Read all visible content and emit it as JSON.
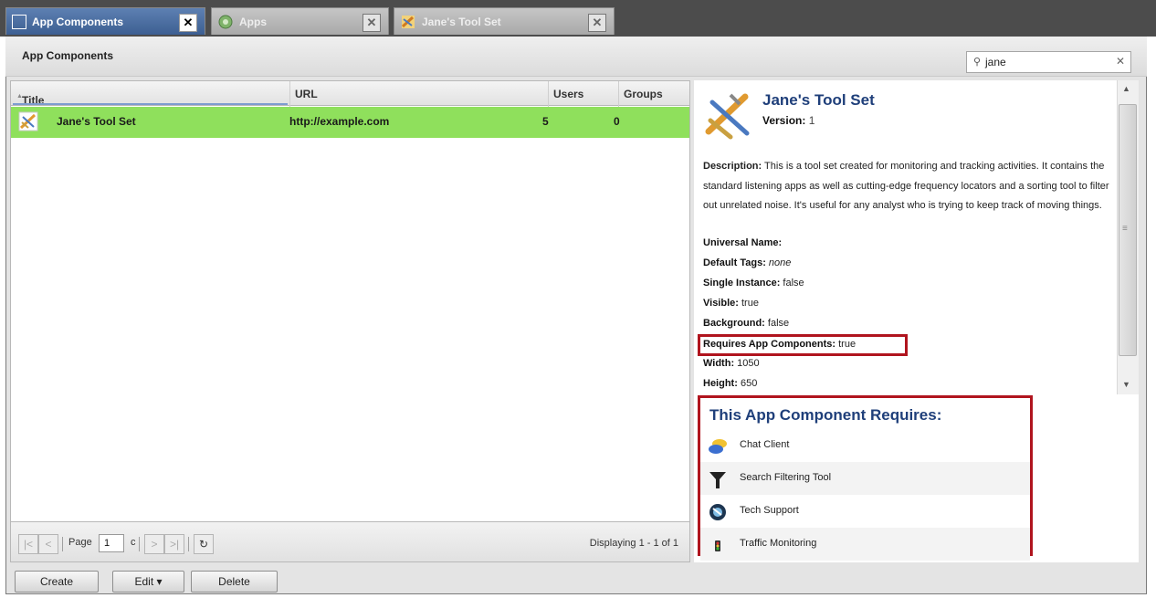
{
  "tabs": [
    {
      "label": "App Components",
      "close": "✕",
      "active": true
    },
    {
      "label": "Apps",
      "close": "✕",
      "active": false
    },
    {
      "label": "Jane's Tool Set",
      "close": "✕",
      "active": false
    }
  ],
  "panel": {
    "title": "App Components"
  },
  "search": {
    "icon": "search-icon",
    "value": "jane",
    "clear": "✕"
  },
  "grid": {
    "columns": {
      "title": "Title",
      "url": "URL",
      "users": "Users",
      "groups": "Groups"
    },
    "sort_indicator": "▲",
    "rows": [
      {
        "title": "Jane's Tool Set",
        "url": "http://example.com",
        "users": "5",
        "groups": "0"
      }
    ]
  },
  "pager": {
    "page_label": "Page",
    "page_value": "1",
    "of_label": "c",
    "displaying": "Displaying 1 - 1 of 1"
  },
  "buttons": {
    "create": "Create",
    "edit": "Edit ▾",
    "delete": "Delete"
  },
  "details": {
    "name": "Jane's Tool Set",
    "version_label": "Version:",
    "version": "1",
    "description_label": "Description:",
    "description": "This is a tool set created for monitoring and tracking activities. It contains the standard listening apps as well as cutting-edge frequency locators and a sorting tool to filter out unrelated noise. It's useful for any analyst who is trying to keep track of moving things.",
    "universal_name_label": "Universal Name:",
    "default_tags_label": "Default Tags:",
    "default_tags": "none",
    "single_instance_label": "Single Instance:",
    "single_instance": "false",
    "visible_label": "Visible:",
    "visible": "true",
    "background_label": "Background:",
    "background": "false",
    "requires_label": "Requires App Components:",
    "requires": "true",
    "width_label": "Width:",
    "width": "1050",
    "height_label": "Height:",
    "height": "650"
  },
  "requires_panel": {
    "title": "This App Component Requires:",
    "items": [
      {
        "label": "Chat Client",
        "icon": "chat-client-icon"
      },
      {
        "label": "Search Filtering Tool",
        "icon": "funnel-icon"
      },
      {
        "label": "Tech Support",
        "icon": "tech-support-icon"
      },
      {
        "label": "Traffic Monitoring",
        "icon": "traffic-light-icon"
      }
    ]
  },
  "colors": {
    "selected_row": "#8fe05c",
    "highlight": "#b0141e",
    "title_blue": "#1f3f7a",
    "active_tab": "#4a6da0"
  }
}
